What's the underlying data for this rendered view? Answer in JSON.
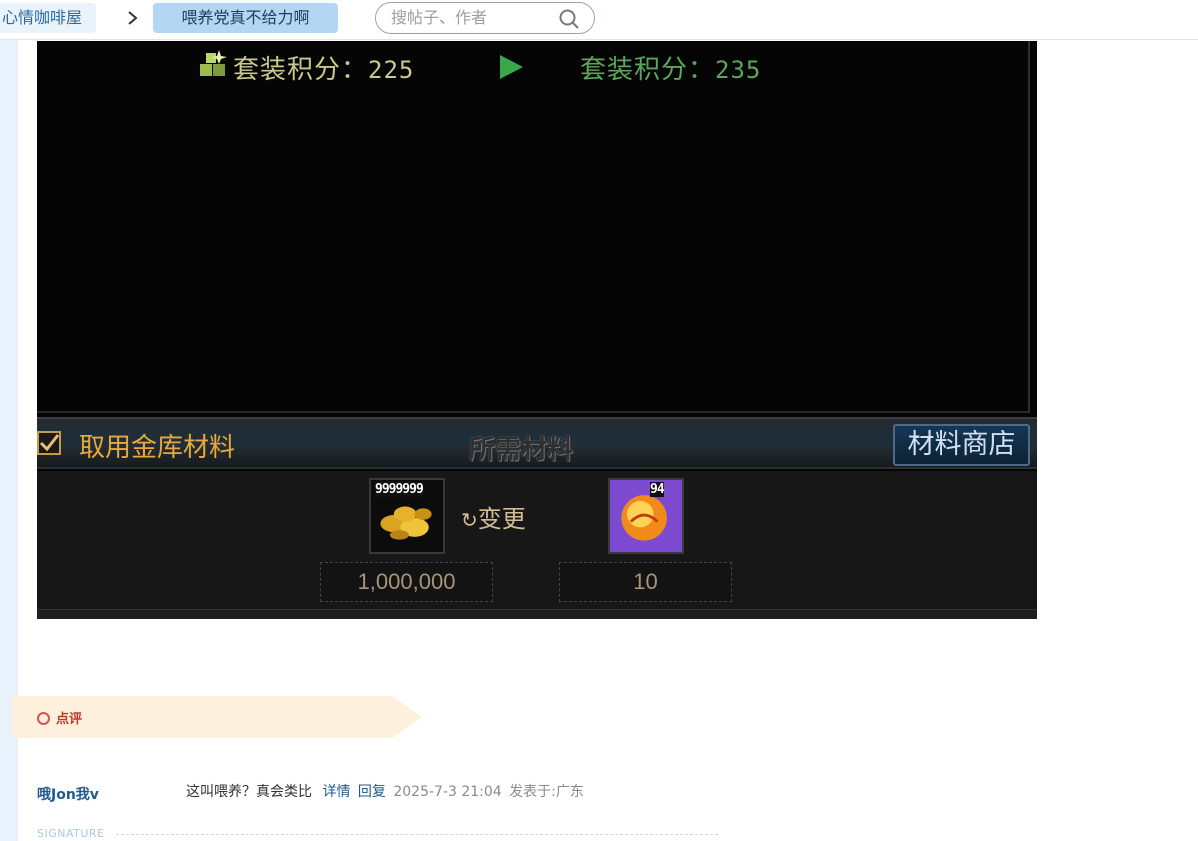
{
  "breadcrumb": {
    "forum": "心情咖啡屋",
    "thread": "喂养党真不给力啊"
  },
  "search": {
    "placeholder": "搜帖子、作者"
  },
  "game": {
    "set_score_label": "套装积分：",
    "set_score_before": "225",
    "set_score_after": "235",
    "use_vault_label": "取用金库材料",
    "required_label": "所需材料",
    "shop_button": "材料商店",
    "gold_stack_count": "9999999",
    "orb_stack_count": "94",
    "change_label": "变更",
    "gold_qty": "1,000,000",
    "orb_qty": "10",
    "colors": {
      "score_before": "#c9c98d",
      "score_after": "#5da55a",
      "vault_label": "#e8a93a"
    }
  },
  "review": {
    "label": "点评"
  },
  "comment": {
    "user": "哦Jon我v",
    "text": "这叫喂养？真会类比",
    "detail_link": "详情",
    "reply_link": "回复",
    "time": "2025-7-3 21:04",
    "location": "发表于:广东"
  },
  "signature": {
    "label": "SIGNATURE"
  }
}
